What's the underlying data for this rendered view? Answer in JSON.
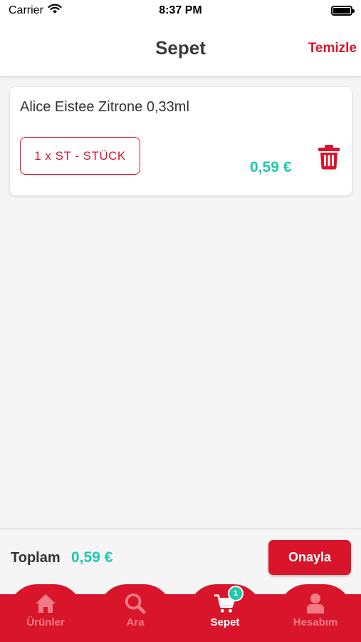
{
  "status_bar": {
    "carrier": "Carrier",
    "time": "8:37 PM"
  },
  "header": {
    "title": "Sepet",
    "clear_label": "Temizle"
  },
  "cart": {
    "items": [
      {
        "name": "Alice Eistee Zitrone 0,33ml",
        "quantity_label": "1 x ST - STÜCK",
        "price": "0,59 €"
      }
    ]
  },
  "footer": {
    "total_label": "Toplam",
    "total_value": "0,59 €",
    "confirm_label": "Onayla"
  },
  "tab_bar": {
    "tabs": [
      {
        "label": "Ürünler",
        "icon": "home-icon",
        "active": false
      },
      {
        "label": "Ara",
        "icon": "search-icon",
        "active": false
      },
      {
        "label": "Sepet",
        "icon": "cart-icon",
        "active": true,
        "badge": "1"
      },
      {
        "label": "Hesabım",
        "icon": "user-icon",
        "active": false
      }
    ]
  },
  "colors": {
    "brand_red": "#d8152a",
    "price_teal": "#1ec9ad",
    "inactive_tab": "#f07b86"
  }
}
